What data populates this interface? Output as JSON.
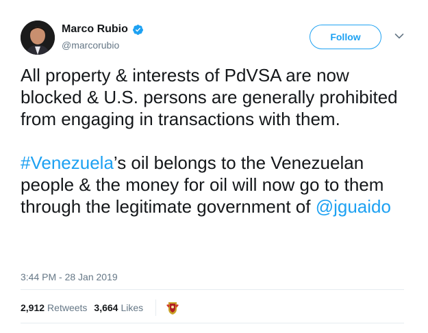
{
  "author": {
    "name": "Marco Rubio",
    "handle": "@marcorubio",
    "verified": true
  },
  "follow_label": "Follow",
  "tweet": {
    "paragraph1": "All property & interests of PdVSA are now blocked & U.S. persons are generally prohibited from engaging in transactions with them.",
    "hashtag": "#Venezuela",
    "paragraph2_rest": "’s oil belongs to the Venezuelan people & the money for oil will now go to them through the legitimate government of",
    "mention": "@jguaido"
  },
  "timestamp": "3:44 PM - 28 Jan 2019",
  "stats": {
    "retweets_count": "2,912",
    "retweets_label": "Retweets",
    "likes_count": "3,664",
    "likes_label": "Likes"
  },
  "colors": {
    "link": "#1da1f2",
    "secondary_text": "#657786",
    "primary_text": "#14171a",
    "divider": "#e6ecf0"
  },
  "icons": {
    "verified": "verified-badge-icon",
    "caret": "chevron-down-icon"
  }
}
